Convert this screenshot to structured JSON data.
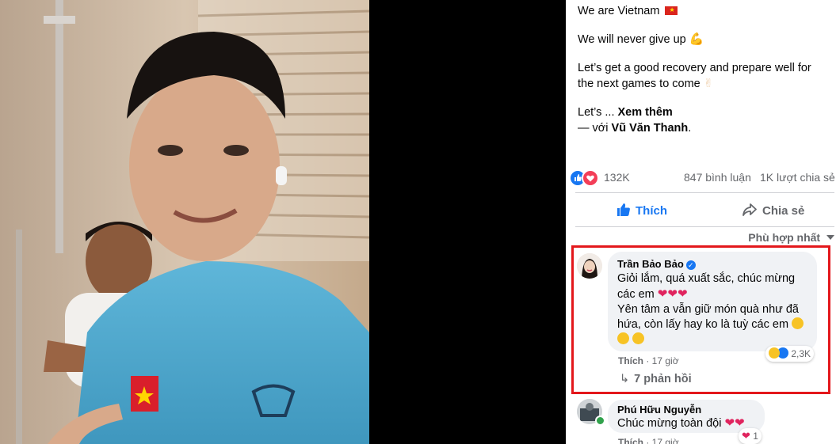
{
  "post": {
    "lines": {
      "line1": "We are Vietnam",
      "line2": "We will never give up",
      "line3a": "Let’s get a good recovery and prepare well for",
      "line3b": "the next games to come",
      "line4_prefix": "Let’s ... ",
      "see_more": "Xem thêm",
      "with_prefix": "— với ",
      "tagged": "Vũ Văn Thanh",
      "with_suffix": "."
    },
    "emoji": {
      "flag": "vietnam-flag",
      "muscle": "flexed-biceps",
      "victory": "victory-hand"
    }
  },
  "stats": {
    "reactions_count": "132K",
    "comments": "847 bình luận",
    "shares": "1K lượt chia sẻ"
  },
  "actions": {
    "like_label": "Thích",
    "share_label": "Chia sẻ"
  },
  "sort": {
    "label": "Phù hợp nhất"
  },
  "comments": [
    {
      "author": "Trần Bảo Bảo",
      "verified": true,
      "text_line1": "Giỏi lắm, quá xuất sắc, chúc mừng",
      "text_line2": "các em",
      "text_line3": "Yên tâm a vẫn giữ món quà như đã",
      "text_line4": "hứa, còn lấy hay ko là tuỳ các em",
      "reaction_count": "2,3K",
      "like_label": "Thích",
      "time": "17 giờ",
      "replies": "7 phản hồi"
    },
    {
      "author": "Phú Hữu Nguyễn",
      "text": "Chúc mừng toàn đội",
      "reaction_count": "1",
      "like_label": "Thích",
      "time": "17 giờ"
    }
  ],
  "colors": {
    "accent": "#1877f2",
    "highlight_border": "#e3171b",
    "muted": "#65676b"
  }
}
